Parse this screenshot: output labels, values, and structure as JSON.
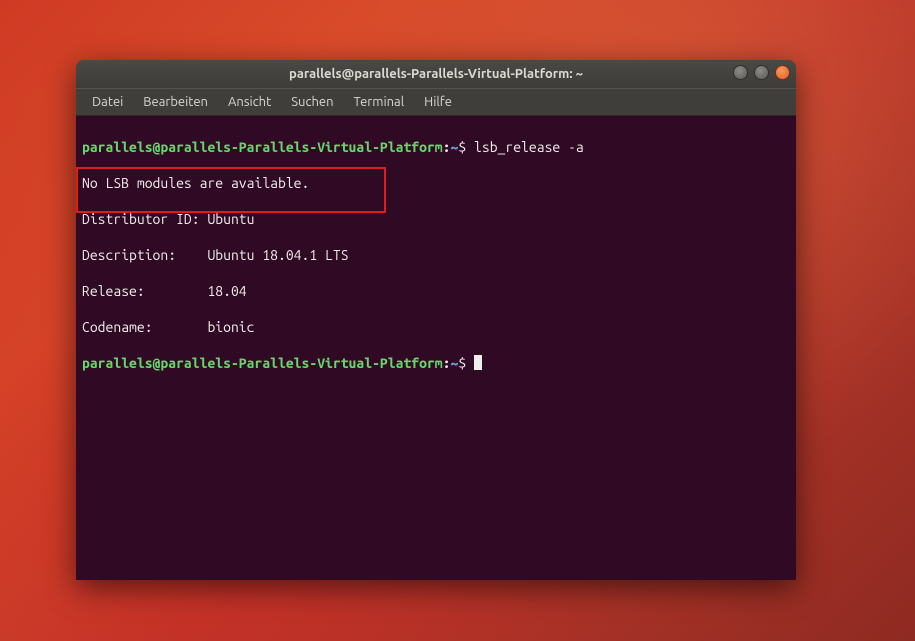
{
  "window": {
    "title": "parallels@parallels-Parallels-Virtual-Platform: ~"
  },
  "menu": {
    "file": "Datei",
    "edit": "Bearbeiten",
    "view": "Ansicht",
    "search": "Suchen",
    "terminal": "Terminal",
    "help": "Hilfe"
  },
  "prompt": {
    "userhost": "parallels@parallels-Parallels-Virtual-Platform",
    "colon": ":",
    "path": "~",
    "dollar": "$"
  },
  "command": " lsb_release -a",
  "output": {
    "line1": "No LSB modules are available.",
    "line2": "Distributor ID: Ubuntu",
    "line3": "Description:    Ubuntu 18.04.1 LTS",
    "line4": "Release:        18.04",
    "line5": "Codename:       bionic"
  }
}
